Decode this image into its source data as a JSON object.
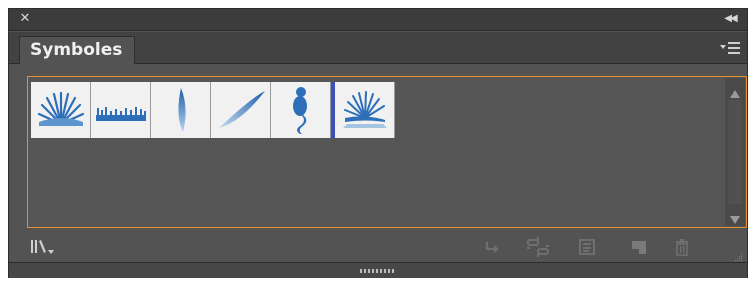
{
  "panel": {
    "title": "Symboles",
    "accent_color": "#e2912e",
    "titlebar_icons": {
      "close": "close-icon",
      "collapse": "double-chevron-icon"
    },
    "menu_icon": "panel-menu-icon"
  },
  "symbols": [
    {
      "icon": "fan-seashell-icon"
    },
    {
      "icon": "grass-strip-icon"
    },
    {
      "icon": "blue-leaf-icon"
    },
    {
      "icon": "diagonal-leaf-icon"
    },
    {
      "icon": "seahorse-icon"
    },
    {
      "icon": "fan-seashell-with-base-icon"
    }
  ],
  "toolbar": {
    "left": [
      "symbol-libraries-menu-icon"
    ],
    "right": [
      "place-symbol-instance-icon",
      "break-link-icon",
      "symbol-options-icon",
      "new-symbol-icon",
      "delete-symbol-icon"
    ]
  },
  "colors": {
    "symbol_blue": "#2d6fb8",
    "insertion_marker": "#3c52b8"
  }
}
